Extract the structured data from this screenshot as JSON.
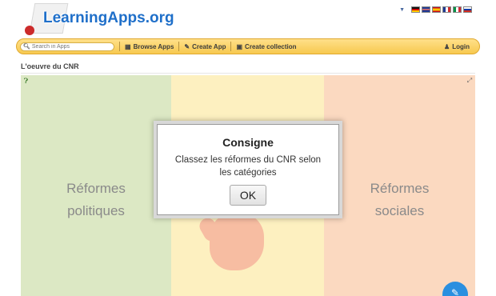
{
  "logo": {
    "name": "LearningApps",
    "tld": ".org"
  },
  "flags": [
    {
      "name": "german-flag-icon",
      "colors": [
        "#111111",
        "#dd0000",
        "#ffce00"
      ]
    },
    {
      "name": "uk-flag-icon",
      "colors": [
        "#1f3a93",
        "#ffffff",
        "#cc2b2b"
      ]
    },
    {
      "name": "spanish-flag-icon",
      "colors": [
        "#c60b1e",
        "#ffc400",
        "#c60b1e"
      ]
    },
    {
      "name": "french-flag-icon",
      "colors": [
        "#1f3a93",
        "#ffffff",
        "#cc2b2b"
      ]
    },
    {
      "name": "italian-flag-icon",
      "colors": [
        "#009246",
        "#ffffff",
        "#ce2b37"
      ]
    },
    {
      "name": "russian-flag-icon",
      "colors": [
        "#ffffff",
        "#0039a6",
        "#d52b1e"
      ]
    }
  ],
  "nav": {
    "search_placeholder": "Search in Apps",
    "browse": "Browse Apps",
    "create": "Create App",
    "collection": "Create collection",
    "login": "Login"
  },
  "page": {
    "title": "L'oeuvre du CNR"
  },
  "app": {
    "columns": [
      {
        "lines": [
          "Réformes",
          "politiques"
        ]
      },
      {
        "lines": []
      },
      {
        "lines": [
          "Réformes",
          "sociales"
        ]
      }
    ],
    "modal": {
      "title": "Consigne",
      "text": "Classez les réformes du CNR selon les catégories",
      "ok": "OK"
    }
  },
  "colors": {
    "accent": "#f7c94f",
    "link": "#1f6fc9",
    "fab": "#2a8fe0"
  }
}
